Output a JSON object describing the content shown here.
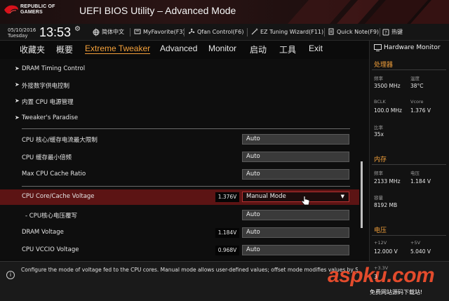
{
  "header": {
    "logo_line1": "REPUBLIC OF",
    "logo_line2": "GAMERS",
    "title": "UEFI BIOS Utility – Advanced Mode",
    "accent": "#c8191f"
  },
  "toolbar": {
    "date": "05/10/2016",
    "day": "Tuesday",
    "time": "13:53",
    "items": [
      {
        "label": "简体中文",
        "icon": "globe-icon"
      },
      {
        "label": "MyFavorite(F3)",
        "icon": "favorite-icon"
      },
      {
        "label": "Qfan Control(F6)",
        "icon": "fan-icon"
      },
      {
        "label": "EZ Tuning Wizard(F11)",
        "icon": "wizard-icon"
      },
      {
        "label": "Quick Note(F9)",
        "icon": "note-icon"
      },
      {
        "label": "热键",
        "icon": "hotkey-icon"
      }
    ]
  },
  "tabs": [
    {
      "label": "收藏夹"
    },
    {
      "label": "概要"
    },
    {
      "label": "Extreme Tweaker"
    },
    {
      "label": "Advanced"
    },
    {
      "label": "Monitor"
    },
    {
      "label": "启动"
    },
    {
      "label": "工具"
    },
    {
      "label": "Exit"
    }
  ],
  "submenus": [
    {
      "label": "DRAM Timing Control"
    },
    {
      "label": "外接数字供电控制"
    },
    {
      "label": "内置 CPU 电源管理"
    },
    {
      "label": "Tweaker's Paradise"
    }
  ],
  "settings": [
    {
      "label": "CPU 核心/缓存电流最大限制",
      "value": "Auto"
    },
    {
      "label": "CPU 缓存最小倍频",
      "value": "Auto"
    },
    {
      "label": "Max CPU Cache Ratio",
      "value": "Auto"
    },
    {
      "label": "CPU Core/Cache Voltage",
      "voltage": "1.376V",
      "value": "Manual Mode"
    },
    {
      "label": "- CPU核心电压覆写",
      "value": "Auto"
    },
    {
      "label": "DRAM Voltage",
      "voltage": "1.184V",
      "value": "Auto"
    },
    {
      "label": "CPU VCCIO Voltage",
      "voltage": "0.968V",
      "value": "Auto"
    }
  ],
  "monitor": {
    "title": "Hardware Monitor",
    "cpu": {
      "section": "处理器",
      "freq_label": "频率",
      "freq": "3500 MHz",
      "temp_label": "温度",
      "temp": "38°C",
      "bclk_label": "BCLK",
      "bclk": "100.0 MHz",
      "vcore_label": "Vcore",
      "vcore": "1.376 V",
      "ratio_label": "比率",
      "ratio": "35x"
    },
    "memory": {
      "section": "内存",
      "freq_label": "频率",
      "freq": "2133 MHz",
      "volt_label": "电压",
      "volt": "1.184 V",
      "cap_label": "容量",
      "cap": "8192 MB"
    },
    "voltage": {
      "section": "电压",
      "v12_label": "+12V",
      "v12": "12.000 V",
      "v5_label": "+5V",
      "v5": "5.040 V",
      "v33_label": "+3.3V",
      "v33": "3"
    }
  },
  "footer": {
    "help": "Configure the mode of voltage fed to the CPU cores. Manual mode allows user-defined values; offset mode modifies values by SVID."
  },
  "watermark": {
    "text": "aspku.com",
    "sub": "免费网站源码下载站!"
  }
}
